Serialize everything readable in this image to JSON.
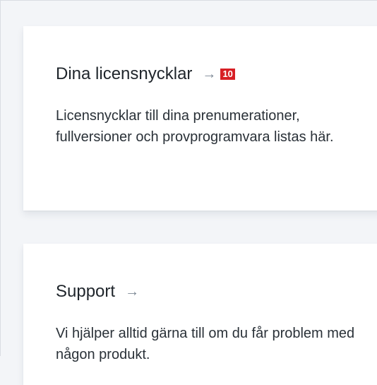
{
  "cards": [
    {
      "title": "Dina licensnycklar",
      "arrow": "→",
      "badge": "10",
      "description": "Licensnycklar till dina prenumerationer, fullversioner och provprogramvara listas här."
    },
    {
      "title": "Support",
      "arrow": "→",
      "description": "Vi hjälper alltid gärna till om du får problem med någon produkt."
    }
  ]
}
